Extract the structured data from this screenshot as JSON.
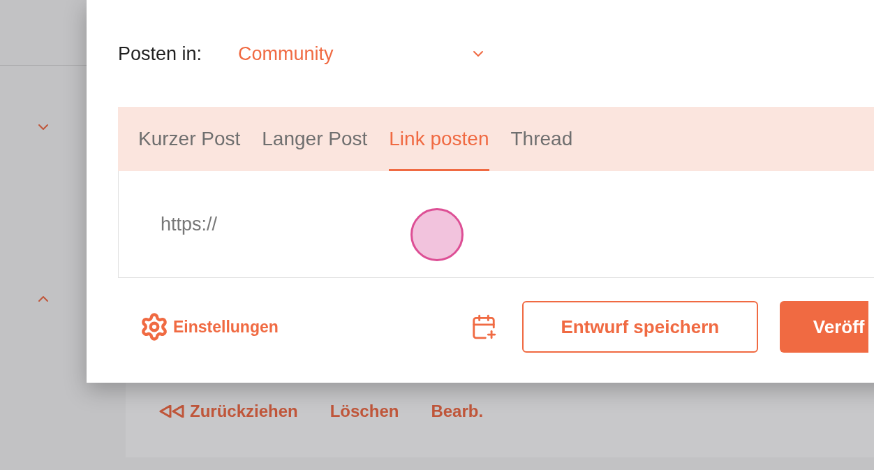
{
  "sidebar": {
    "toggles": [
      {
        "expanded": false
      },
      {
        "expanded": true
      }
    ]
  },
  "background_actions": [
    {
      "label": "Zurückziehen",
      "kind": "retract"
    },
    {
      "label": "Löschen",
      "kind": "plain"
    },
    {
      "label": "Bearb.",
      "kind": "plain"
    }
  ],
  "dialog": {
    "post_in": {
      "label": "Posten in:",
      "value": "Community"
    },
    "tabs": [
      {
        "label": "Kurzer Post",
        "selected": false
      },
      {
        "label": "Langer Post",
        "selected": false
      },
      {
        "label": "Link posten",
        "selected": true
      },
      {
        "label": "Thread",
        "selected": false
      }
    ],
    "url_field": {
      "placeholder": "https://"
    },
    "settings": "Einstellungen",
    "buttons": [
      {
        "label": "Entwurf speichern",
        "kind": "outline"
      },
      {
        "label": "Veröff",
        "kind": "primary"
      }
    ]
  }
}
